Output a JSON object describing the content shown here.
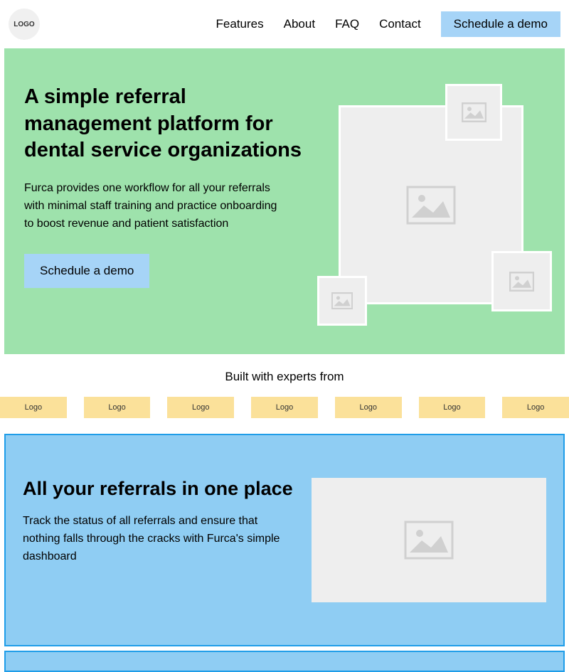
{
  "header": {
    "logo_text": "LOGO",
    "nav": {
      "features": "Features",
      "about": "About",
      "faq": "FAQ",
      "contact": "Contact"
    },
    "cta": "Schedule a demo"
  },
  "hero": {
    "title": "A simple referral management platform for dental service organizations",
    "subtitle": "Furca provides one workflow for all your referrals with minimal staff training and practice onboarding to boost revenue and patient satisfaction",
    "cta": "Schedule a demo"
  },
  "experts": {
    "title": "Built with experts from",
    "logos": [
      "Logo",
      "Logo",
      "Logo",
      "Logo",
      "Logo",
      "Logo",
      "Logo"
    ]
  },
  "feature": {
    "title": "All your referrals in one place",
    "subtitle": "Track the status of all referrals and ensure that nothing falls through the cracks with Furca's simple dashboard"
  }
}
